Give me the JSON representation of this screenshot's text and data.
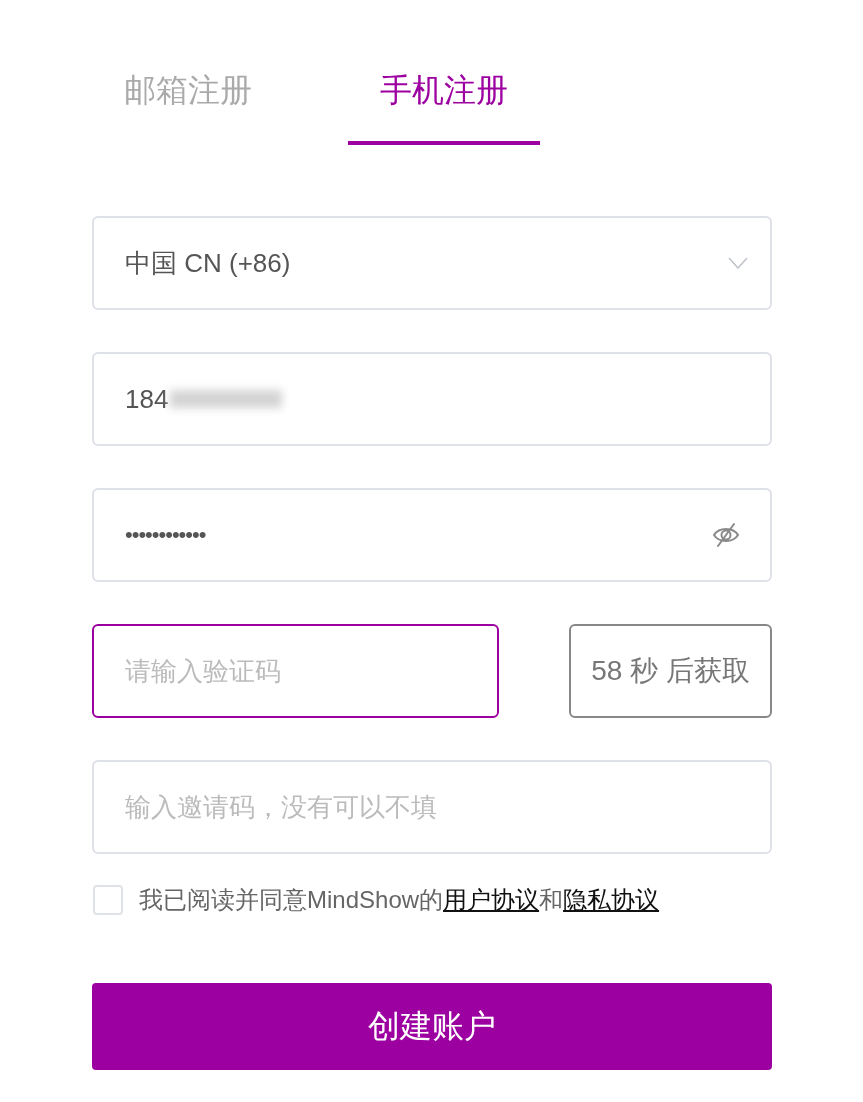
{
  "tabs": [
    {
      "label": "邮箱注册",
      "selected": false
    },
    {
      "label": "手机注册",
      "selected": true
    }
  ],
  "country_select": {
    "value": "中国 CN (+86)"
  },
  "phone_field": {
    "value": "184",
    "redacted": true
  },
  "password_field": {
    "value": "••••••••••••",
    "revealed": false
  },
  "code_field": {
    "placeholder": "请输入验证码",
    "focused": true
  },
  "code_button": {
    "label": "58 秒 后获取",
    "disabled": true
  },
  "invite_field": {
    "placeholder": "输入邀请码，没有可以不填"
  },
  "agreement": {
    "checked": false,
    "parts": [
      {
        "kind": "text",
        "text": "我已阅读并同意MindShow的"
      },
      {
        "kind": "link",
        "text": "用户协议"
      },
      {
        "kind": "text",
        "text": "和"
      },
      {
        "kind": "link",
        "text": "隐私协议"
      }
    ]
  },
  "submit_button": {
    "label": "创建账户"
  }
}
